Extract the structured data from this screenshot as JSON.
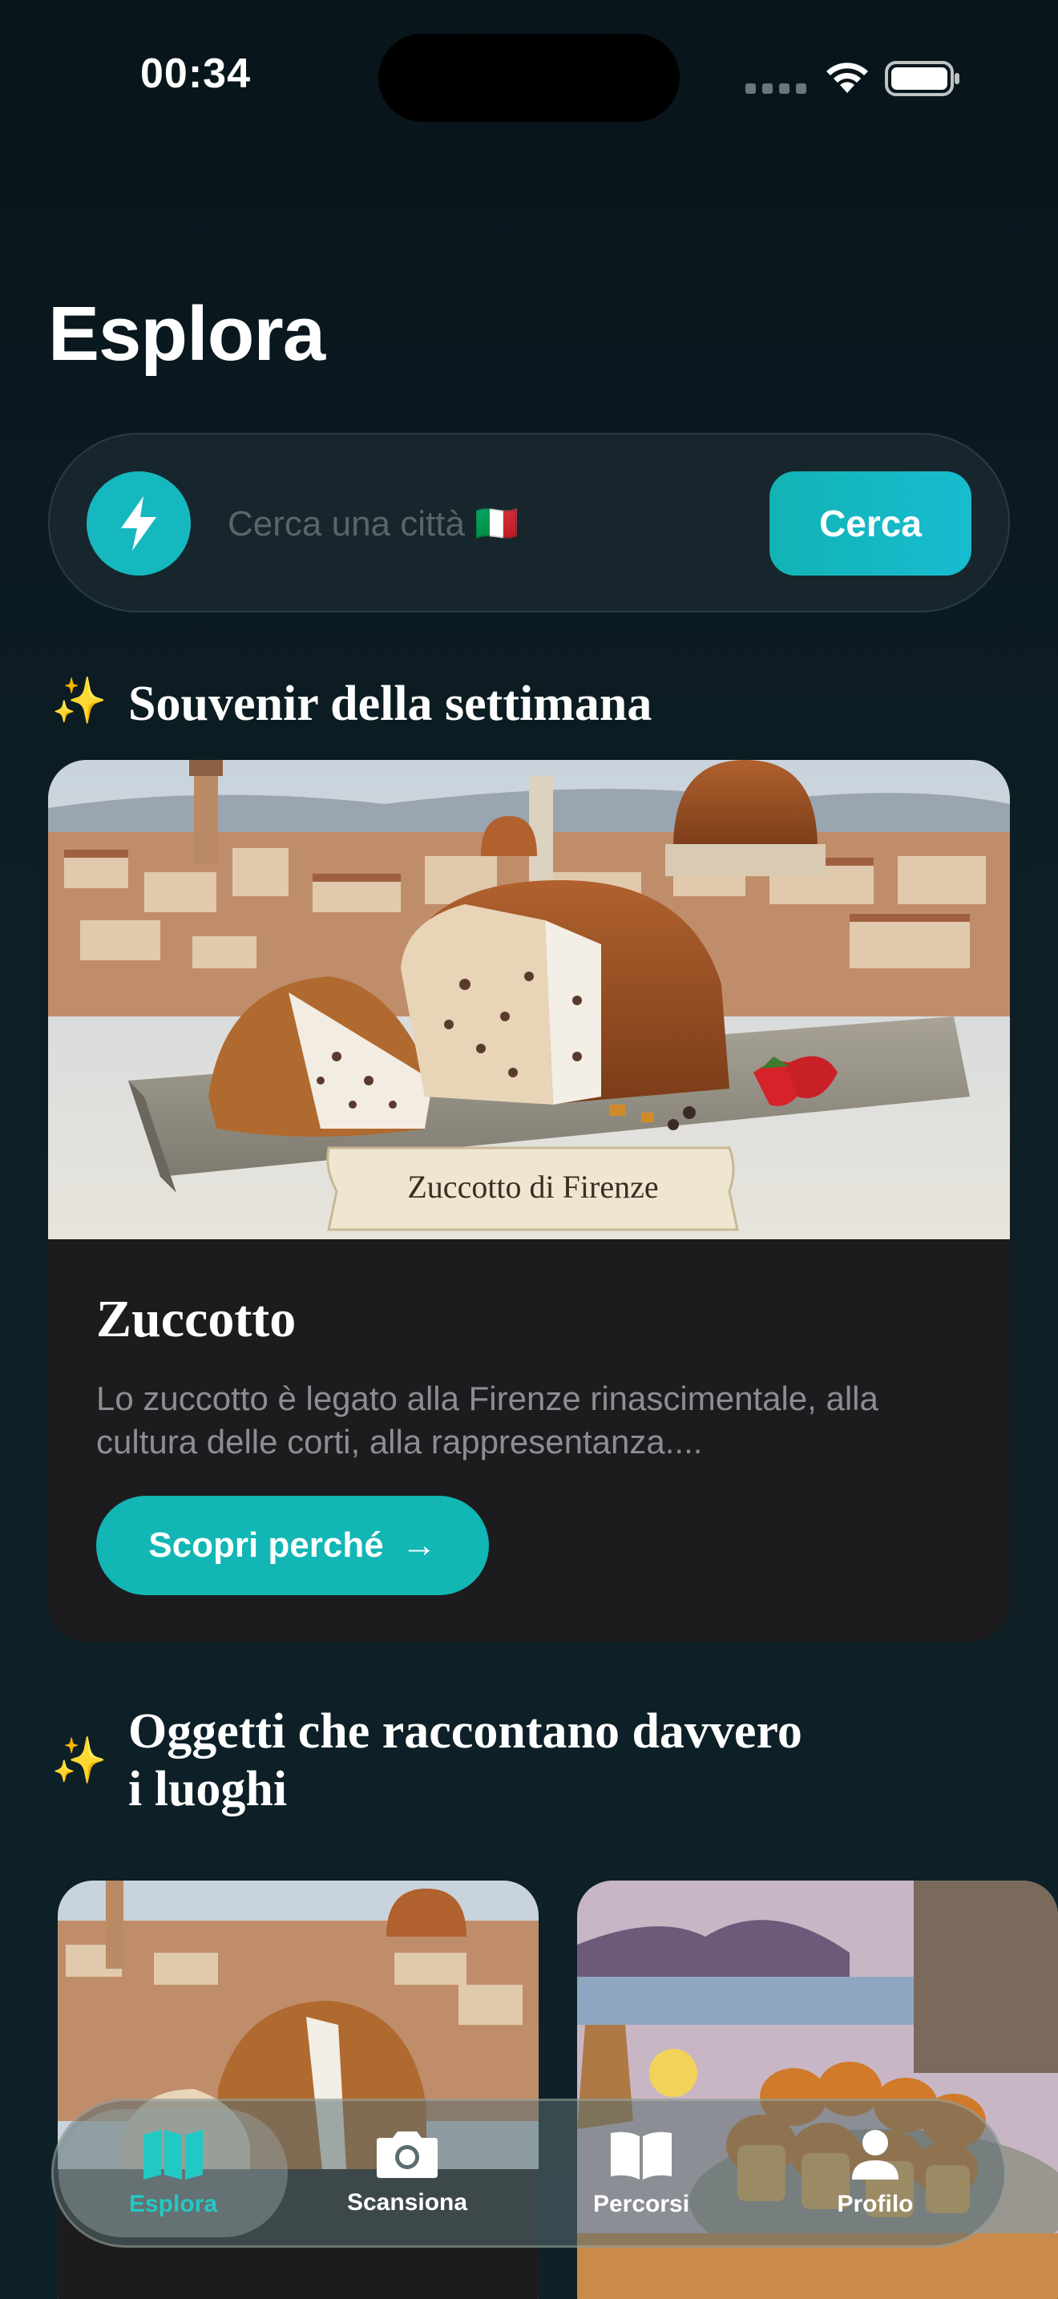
{
  "status_bar": {
    "time": "00:34"
  },
  "page": {
    "title": "Esplora"
  },
  "search": {
    "placeholder": "Cerca una città 🇮🇹",
    "button_label": "Cerca"
  },
  "weekly_souvenir": {
    "section_title": "Souvenir della settimana",
    "image_caption": "Zuccotto di Firenze",
    "name": "Zuccotto",
    "description": "Lo zuccotto è legato alla Firenze rinascimentale, alla cultura delle corti, alla rappresentanza....",
    "button_label": "Scopri perché",
    "button_arrow": "→"
  },
  "objects_section": {
    "title_line1": "Oggetti che raccontano davvero",
    "title_line2": "i luoghi",
    "cards": [
      {
        "image": "zuccotto-florence"
      },
      {
        "image": "babà-naples"
      }
    ]
  },
  "tab_bar": {
    "tabs": [
      {
        "label": "Esplora",
        "icon": "map-icon",
        "active": true
      },
      {
        "label": "Scansiona",
        "icon": "camera-icon",
        "active": false
      },
      {
        "label": "Percorsi",
        "icon": "book-icon",
        "active": false
      },
      {
        "label": "Profilo",
        "icon": "person-icon",
        "active": false
      }
    ]
  },
  "colors": {
    "accent": "#15b8be",
    "background": "#0b1a20",
    "card": "#1c1c1e"
  }
}
